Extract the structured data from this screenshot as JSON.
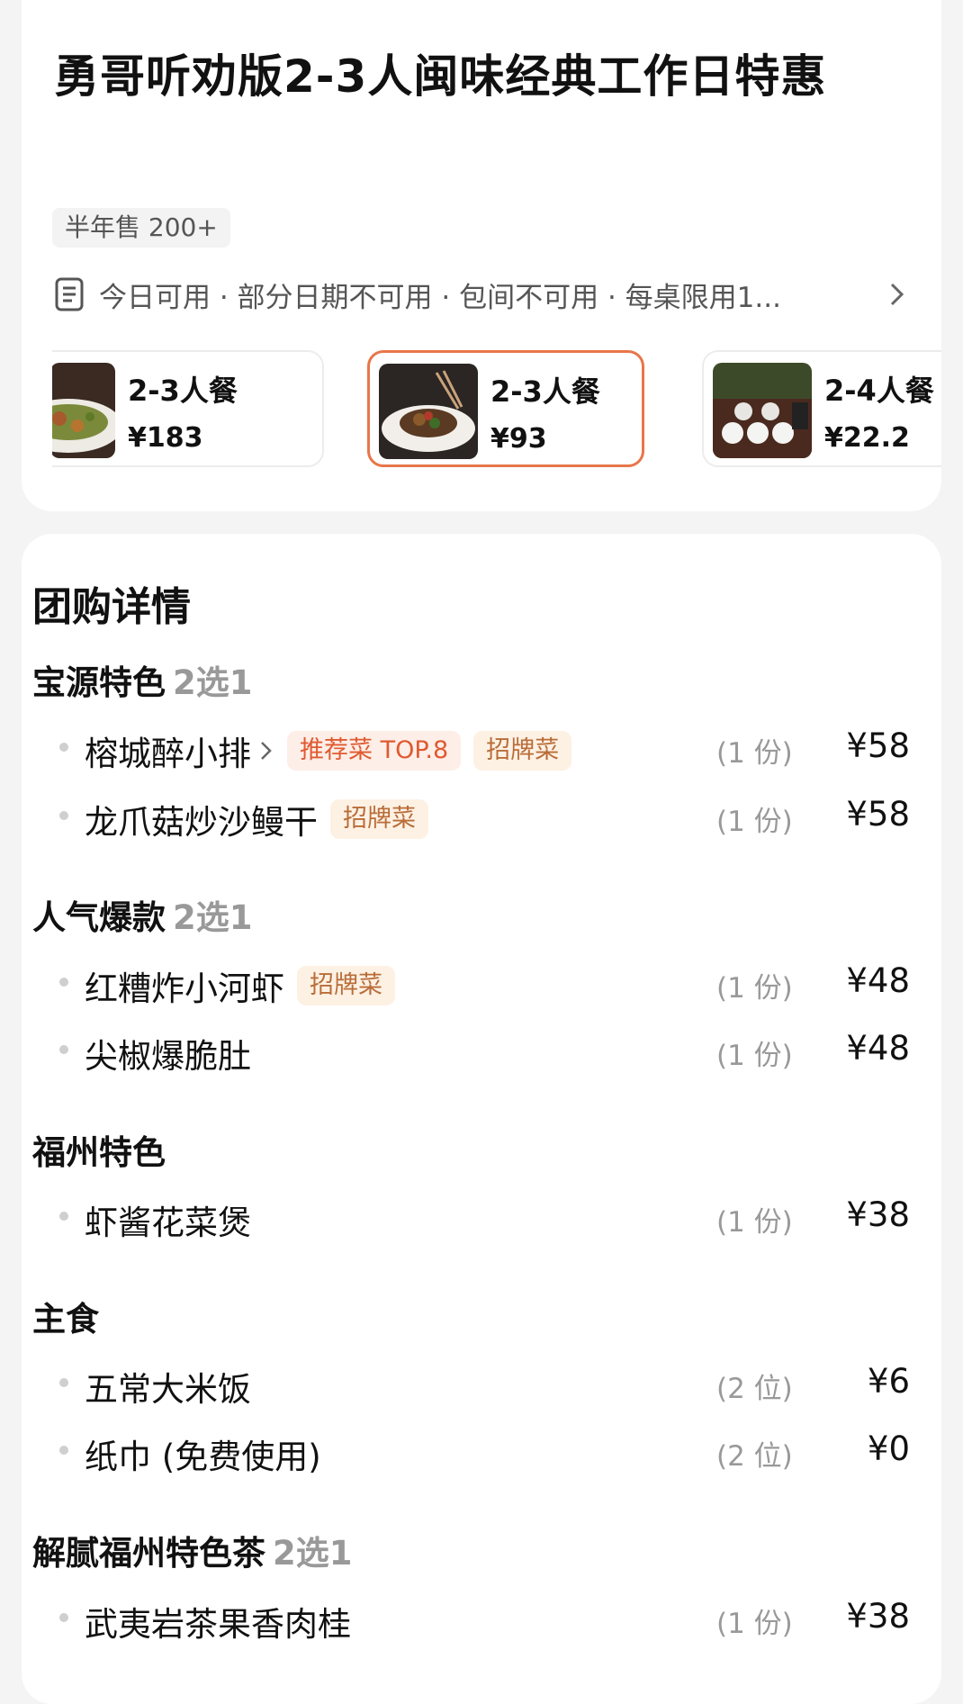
{
  "deal": {
    "title": "勇哥听劝版2-3人闽味经典工作日特惠",
    "sales": "半年售 200+",
    "rules": "今日可用 · 部分日期不可用 · 包间不可用 · 每桌限用1..."
  },
  "combos": [
    {
      "name": "2-3人餐",
      "price": "¥183",
      "selected": false
    },
    {
      "name": "2-3人餐",
      "price": "¥93",
      "selected": true
    },
    {
      "name": "2-4人餐",
      "price": "¥22.2",
      "selected": false
    }
  ],
  "detail": {
    "title": "团购详情",
    "sections": [
      {
        "title": "宝源特色",
        "pick": "2选1",
        "items": [
          {
            "name": "榕城醉小排",
            "tags": [
              "推荐菜 TOP.8",
              "招牌菜"
            ],
            "qty": "(1 份)",
            "price": "¥58"
          },
          {
            "name": "龙爪菇炒沙鳗干",
            "tags": [
              "招牌菜"
            ],
            "qty": "(1 份)",
            "price": "¥58"
          }
        ]
      },
      {
        "title": "人气爆款",
        "pick": "2选1",
        "items": [
          {
            "name": "红糟炸小河虾",
            "tags": [
              "招牌菜"
            ],
            "qty": "(1 份)",
            "price": "¥48"
          },
          {
            "name": "尖椒爆脆肚",
            "tags": [],
            "qty": "(1 份)",
            "price": "¥48"
          }
        ]
      },
      {
        "title": "福州特色",
        "pick": "",
        "items": [
          {
            "name": "虾酱花菜煲",
            "tags": [],
            "qty": "(1 份)",
            "price": "¥38"
          }
        ]
      },
      {
        "title": "主食",
        "pick": "",
        "items": [
          {
            "name": "五常大米饭",
            "tags": [],
            "qty": "(2 位)",
            "price": "¥6"
          },
          {
            "name": "纸巾 (免费使用)",
            "tags": [],
            "qty": "(2 位)",
            "price": "¥0"
          }
        ]
      },
      {
        "title": "解腻福州特色茶",
        "pick": "2选1",
        "items": [
          {
            "name": "武夷岩茶果香肉桂",
            "tags": [],
            "qty": "(1 份)",
            "price": "¥38"
          }
        ]
      }
    ]
  },
  "colors": {
    "accent": "#e8764a",
    "tag_recommend_text": "#e05a30",
    "tag_signature_text": "#b96d38",
    "muted": "#999999"
  },
  "icons": {
    "rules": "document-icon",
    "rules_more": "chevron-right-icon",
    "dish_more": "chevron-right-icon"
  }
}
